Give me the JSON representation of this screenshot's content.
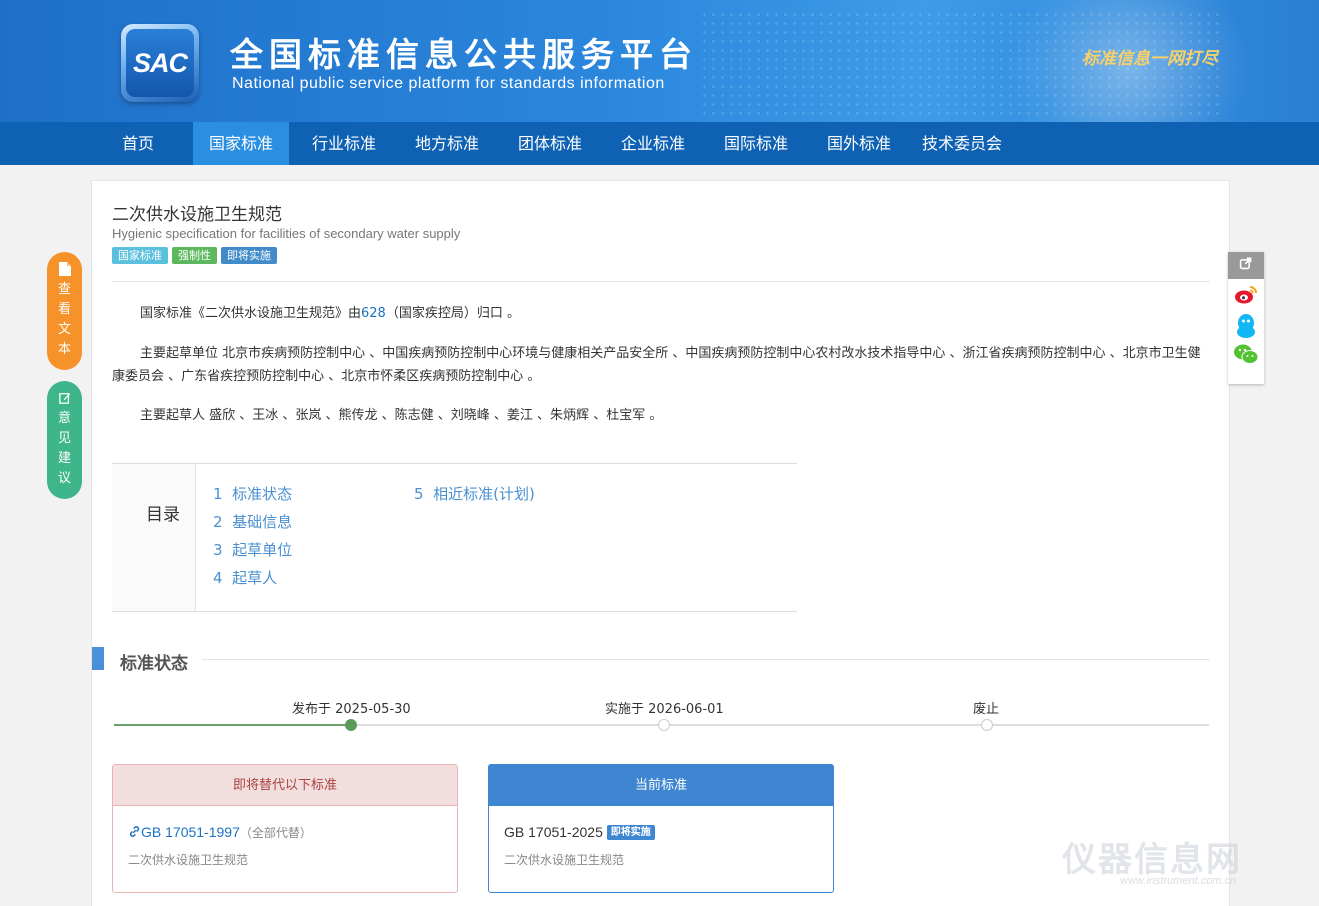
{
  "header": {
    "logo_text": "SAC",
    "title_cn": "全国标准信息公共服务平台",
    "title_en": "National public service platform  for standards information",
    "slogan": "标准信息一网打尽"
  },
  "nav": {
    "items": [
      {
        "label": "首页"
      },
      {
        "label": "国家标准"
      },
      {
        "label": "行业标准"
      },
      {
        "label": "地方标准"
      },
      {
        "label": "团体标准"
      },
      {
        "label": "企业标准"
      },
      {
        "label": "国际标准"
      },
      {
        "label": "国外标准"
      },
      {
        "label": "技术委员会"
      }
    ],
    "active": "国家标准"
  },
  "standard": {
    "title_cn": "二次供水设施卫生规范",
    "title_en": "Hygienic specification for facilities of secondary water supply",
    "tags": [
      {
        "label": "国家标准",
        "color": "#5bc0de"
      },
      {
        "label": "强制性",
        "color": "#5cb85c"
      },
      {
        "label": "即将实施",
        "color": "#428bca"
      }
    ]
  },
  "intro": {
    "p1_prefix": "国家标准《二次供水设施卫生规范》由",
    "p1_link": "628",
    "p1_suffix": "（国家疾控局）归口 。",
    "p2": "主要起草单位 北京市疾病预防控制中心 、中国疾病预防控制中心环境与健康相关产品安全所 、中国疾病预防控制中心农村改水技术指导中心 、浙江省疾病预防控制中心 、北京市卫生健康委员会 、广东省疾控预防控制中心 、北京市怀柔区疾病预防控制中心 。",
    "p3": "主要起草人 盛欣 、王冰 、张岚 、熊传龙 、陈志健 、刘晓峰 、姜江 、朱炳辉 、杜宝军 。"
  },
  "toc": {
    "label": "目录",
    "items": [
      {
        "num": "1",
        "text": "标准状态"
      },
      {
        "num": "2",
        "text": "基础信息"
      },
      {
        "num": "3",
        "text": "起草单位"
      },
      {
        "num": "4",
        "text": "起草人"
      },
      {
        "num": "5",
        "text": "相近标准(计划)"
      }
    ]
  },
  "status_section": {
    "title": "标准状态",
    "timeline": [
      {
        "label": "发布于 2025-05-30"
      },
      {
        "label": "实施于 2026-06-01"
      },
      {
        "label": "废止"
      }
    ],
    "timeline_completed_steps": 1,
    "replace_box": {
      "header": "即将替代以下标准",
      "code": "GB 17051-1997",
      "note": "（全部代替）",
      "name": "二次供水设施卫生规范"
    },
    "current_box": {
      "header": "当前标准",
      "code": "GB 17051-2025",
      "badge": "即将实施",
      "name": "二次供水设施卫生规范"
    }
  },
  "side_buttons": {
    "view_text": [
      "查",
      "看",
      "文",
      "本"
    ],
    "feedback": [
      "意",
      "见",
      "建",
      "议"
    ]
  },
  "share": {
    "icons": [
      "share-icon",
      "weibo-icon",
      "qq-icon",
      "wechat-icon"
    ]
  },
  "watermark": {
    "text": "仪器信息网",
    "sub": "www.instrument.com.cn"
  },
  "colors": {
    "header_blue": "#2a86dc",
    "nav_blue": "#0f62b3",
    "nav_active": "#2a8fe0",
    "link": "#1a71c4",
    "orange": "#f5922a",
    "green": "#3eb58a"
  }
}
